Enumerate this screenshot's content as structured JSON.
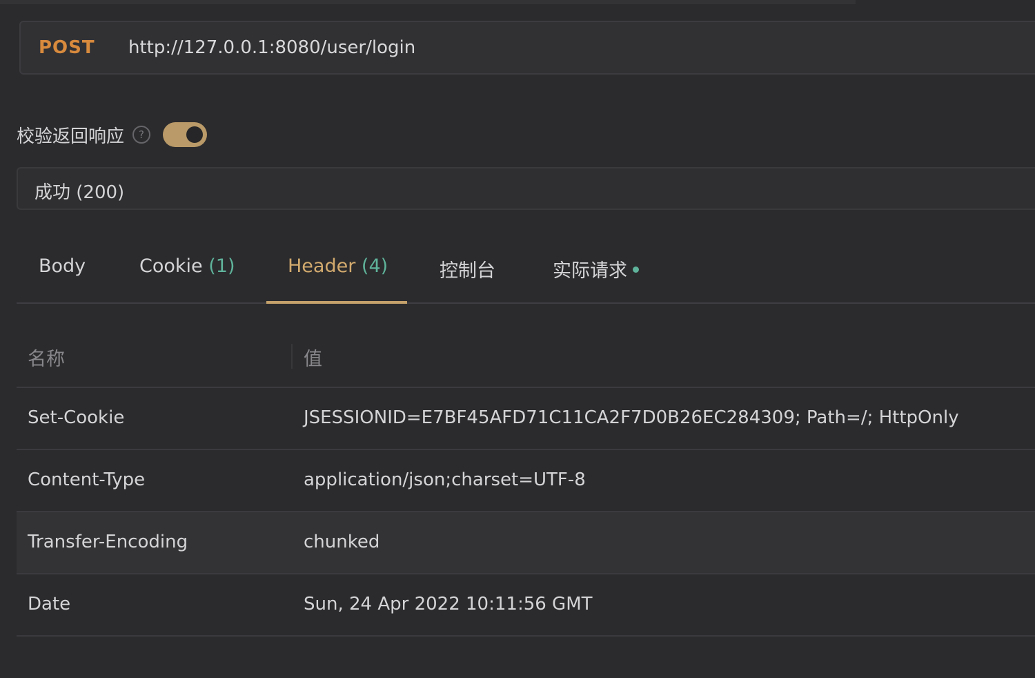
{
  "request": {
    "method": "POST",
    "url": "http://127.0.0.1:8080/user/login"
  },
  "validate": {
    "label": "校验返回响应",
    "help_icon": "?",
    "enabled": true
  },
  "response_status": "成功 (200)",
  "tabs": [
    {
      "label": "Body",
      "count": ""
    },
    {
      "label": "Cookie",
      "count": "(1)"
    },
    {
      "label": "Header",
      "count": "(4)",
      "active": true
    },
    {
      "label": "控制台",
      "count": ""
    },
    {
      "label": "实际请求",
      "count": "",
      "dot": true
    }
  ],
  "headers_table": {
    "columns": [
      "名称",
      "值"
    ],
    "rows": [
      {
        "name": "Set-Cookie",
        "value": "JSESSIONID=E7BF45AFD71C11CA2F7D0B26EC284309; Path=/; HttpOnly"
      },
      {
        "name": "Content-Type",
        "value": "application/json;charset=UTF-8"
      },
      {
        "name": "Transfer-Encoding",
        "value": "chunked"
      },
      {
        "name": "Date",
        "value": "Sun, 24 Apr 2022 10:11:56 GMT"
      }
    ]
  },
  "colors": {
    "method": "#d88a3d",
    "accent": "#c4a06a",
    "count": "#5fb39a",
    "background": "#2b2b2d"
  }
}
